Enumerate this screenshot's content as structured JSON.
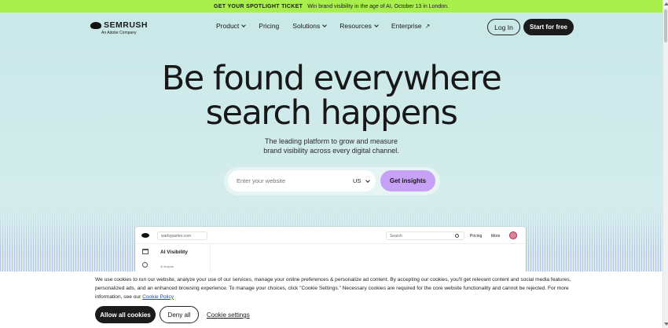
{
  "banner": {
    "highlight": "GET YOUR SPOTLIGHT TICKET",
    "text": "Win brand visibility in the age of AI, October 13 in London."
  },
  "brand": {
    "name": "SEMRUSH",
    "tagline": "An Adobe Company",
    "icon": "semrush-logo-icon"
  },
  "nav": {
    "items": [
      {
        "label": "Product",
        "dropdown": true
      },
      {
        "label": "Pricing",
        "dropdown": false
      },
      {
        "label": "Solutions",
        "dropdown": true
      },
      {
        "label": "Resources",
        "dropdown": true
      },
      {
        "label": "Enterprise",
        "external": true
      }
    ],
    "login_label": "Log In",
    "start_label": "Start for free"
  },
  "hero": {
    "title_line1": "Be found everywhere",
    "title_line2": "search happens",
    "subtitle_line1": "The leading platform to grow and measure",
    "subtitle_line2": "brand visibility across every digital channel."
  },
  "search": {
    "placeholder": "Enter your website",
    "country": "US",
    "button_label": "Get insights"
  },
  "preview": {
    "url": "warbyparker.com",
    "search_placeholder": "Search",
    "pricing": "Pricing",
    "more": "More",
    "title": "AI Visibility",
    "sub": "AI Analysis"
  },
  "cookie": {
    "text": "We use cookies to run our website, analyze your use of our services, manage your online preferences & personalize ad content. By accepting our cookies, you'll get relevant content and social media features, personalized ads, and an enhanced browsing experience. To manage your choices, click \"Cookie Settings.\" Necessary cookies are required for the core website functionality and cannot be rejected. For more information, see our",
    "policy_link": "Cookie Policy",
    "allow_label": "Allow all cookies",
    "deny_label": "Deny all",
    "settings_label": "Cookie settings"
  },
  "colors": {
    "banner_bg": "#a8ef4c",
    "hero_bg": "#c8e7e7",
    "cta_purple": "#c6a1f5",
    "dark": "#1b1b1b"
  }
}
